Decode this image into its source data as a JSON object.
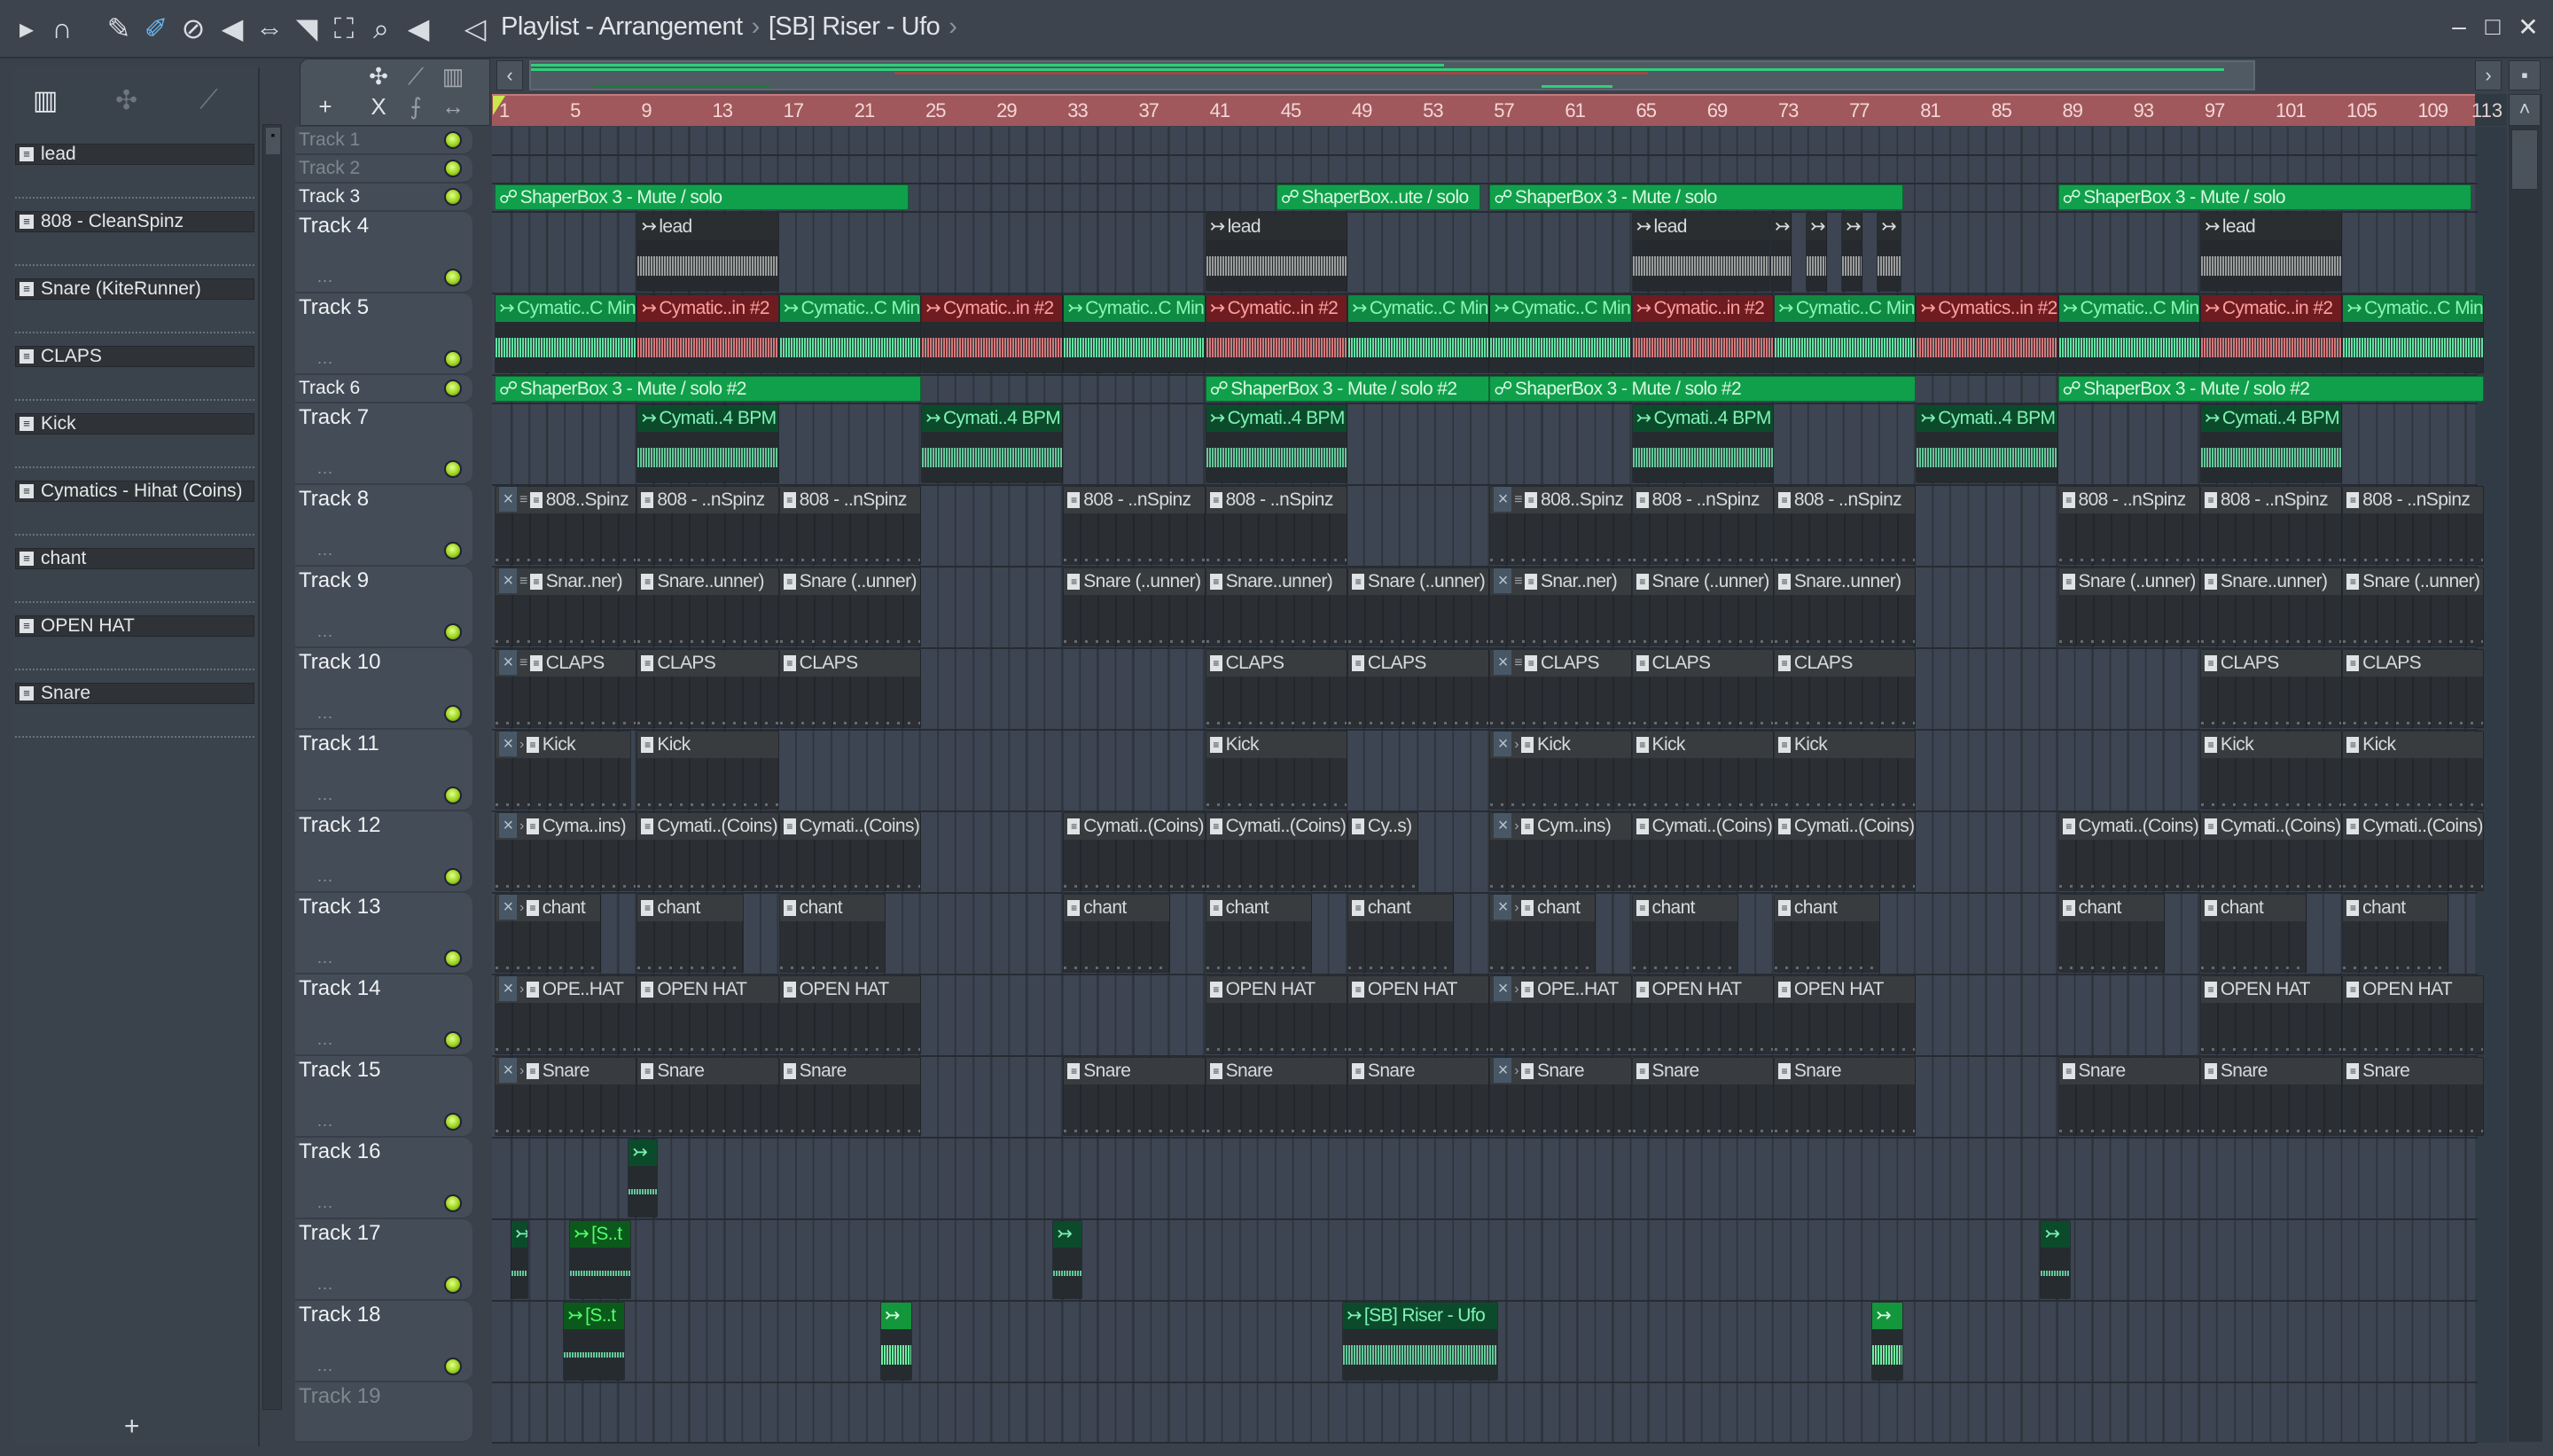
{
  "titlebar": {
    "title": "Playlist - Arrangement",
    "pattern": "[SB] Riser - Ufo",
    "separator": "›",
    "tools": [
      "play-icon",
      "magnet-icon",
      "pencil-icon",
      "paint-icon",
      "delete-icon",
      "mute-icon",
      "slip-icon",
      "slice-icon",
      "select-icon",
      "zoom-icon",
      "playback-icon"
    ],
    "window": {
      "minimize": "–",
      "maximize": "□",
      "close": "✕"
    }
  },
  "accent": {
    "ruler": "#a0585c",
    "auto_clip": "#10a04b",
    "led": "#9bd420"
  },
  "channel_rack": {
    "channels": [
      "lead",
      "808 - CleanSpinz",
      "Snare (KiteRunner)",
      "CLAPS",
      "Kick",
      "Cymatics - Hihat (Coins)",
      "chant",
      "OPEN HAT",
      "Snare"
    ],
    "add_label": "+"
  },
  "ruler": {
    "labels": [
      "1",
      "5",
      "9",
      "13",
      "17",
      "21",
      "25",
      "29",
      "33",
      "37",
      "41",
      "45",
      "49",
      "53",
      "57",
      "61",
      "65",
      "69",
      "73",
      "77",
      "81",
      "85",
      "89",
      "93",
      "97",
      "101",
      "105",
      "109",
      "113"
    ]
  },
  "tracks": [
    {
      "name": "Track 1",
      "dimmed": true,
      "clips": []
    },
    {
      "name": "Track 2",
      "dimmed": true,
      "clips": []
    },
    {
      "name": "Track 3",
      "clips": [
        {
          "s": 1,
          "l": 23.3,
          "t": "auto",
          "label": "ShaperBox 3 - Mute / solo"
        },
        {
          "s": 45,
          "l": 11.5,
          "t": "auto",
          "label": "ShaperBox..ute / solo"
        },
        {
          "s": 57,
          "l": 23.3,
          "t": "auto",
          "label": "ShaperBox 3 - Mute / solo"
        },
        {
          "s": 89,
          "l": 23.3,
          "t": "auto",
          "label": "ShaperBox 3 - Mute / solo"
        }
      ]
    },
    {
      "name": "Track 4",
      "clips": [
        {
          "s": 9,
          "l": 8,
          "t": "audio-gray",
          "label": "lead"
        },
        {
          "s": 41,
          "l": 8,
          "t": "audio-gray",
          "label": "lead"
        },
        {
          "s": 65,
          "l": 7.8,
          "t": "audio-gray",
          "label": "lead"
        },
        {
          "s": 72.8,
          "l": 1.2,
          "t": "audio-gray",
          "label": ""
        },
        {
          "s": 74.8,
          "l": 1.2,
          "t": "audio-gray",
          "label": ""
        },
        {
          "s": 76.8,
          "l": 1.2,
          "t": "audio-gray",
          "label": ""
        },
        {
          "s": 78.8,
          "l": 1.4,
          "t": "audio-gray",
          "label": ""
        },
        {
          "s": 97,
          "l": 8,
          "t": "audio-gray",
          "label": "lead"
        }
      ]
    },
    {
      "name": "Track 5",
      "clips": [
        {
          "s": 1,
          "l": 8,
          "t": "audio-green",
          "label": "Cymatic..C Min"
        },
        {
          "s": 9,
          "l": 8,
          "t": "audio-red",
          "label": "Cymatic..in #2"
        },
        {
          "s": 17,
          "l": 8,
          "t": "audio-green",
          "label": "Cymatic..C Min"
        },
        {
          "s": 25,
          "l": 8,
          "t": "audio-red",
          "label": "Cymatic..in #2"
        },
        {
          "s": 33,
          "l": 8,
          "t": "audio-green",
          "label": "Cymatic..C Min"
        },
        {
          "s": 41,
          "l": 8,
          "t": "audio-red",
          "label": "Cymatic..in #2"
        },
        {
          "s": 49,
          "l": 8,
          "t": "audio-green",
          "label": "Cymatic..C Min"
        },
        {
          "s": 57,
          "l": 8,
          "t": "audio-green",
          "label": "Cymatic..C Min"
        },
        {
          "s": 65,
          "l": 8,
          "t": "audio-red",
          "label": "Cymatic..in #2"
        },
        {
          "s": 73,
          "l": 8,
          "t": "audio-green",
          "label": "Cymatic..C Min"
        },
        {
          "s": 81,
          "l": 8,
          "t": "audio-red",
          "label": "Cymatics..in #2"
        },
        {
          "s": 89,
          "l": 8,
          "t": "audio-green",
          "label": "Cymatic..C Min"
        },
        {
          "s": 97,
          "l": 8,
          "t": "audio-red",
          "label": "Cymatic..in #2"
        },
        {
          "s": 105,
          "l": 8,
          "t": "audio-green",
          "label": "Cymatic..C Min"
        }
      ]
    },
    {
      "name": "Track 6",
      "clips": [
        {
          "s": 1,
          "l": 24,
          "t": "auto",
          "label": "ShaperBox 3 - Mute / solo #2"
        },
        {
          "s": 41,
          "l": 16,
          "t": "auto",
          "label": "ShaperBox 3 - Mute / solo #2"
        },
        {
          "s": 57,
          "l": 24,
          "t": "auto",
          "label": "ShaperBox 3 - Mute / solo #2"
        },
        {
          "s": 89,
          "l": 24,
          "t": "auto",
          "label": "ShaperBox 3 - Mute / solo #2"
        }
      ]
    },
    {
      "name": "Track 7",
      "clips": [
        {
          "s": 9,
          "l": 8,
          "t": "audio-dark",
          "label": "Cymati..4 BPM"
        },
        {
          "s": 25,
          "l": 8,
          "t": "audio-dark",
          "label": "Cymati..4 BPM"
        },
        {
          "s": 41,
          "l": 8,
          "t": "audio-dark",
          "label": "Cymati..4 BPM"
        },
        {
          "s": 65,
          "l": 8,
          "t": "audio-dark",
          "label": "Cymati..4 BPM"
        },
        {
          "s": 81,
          "l": 8,
          "t": "audio-dark",
          "label": "Cymati..4 BPM"
        },
        {
          "s": 97,
          "l": 8,
          "t": "audio-dark",
          "label": "Cymati..4 BPM"
        }
      ]
    },
    {
      "name": "Track 8",
      "clips": [
        {
          "s": 1,
          "l": 8,
          "t": "pattern",
          "label": "808..Spinz",
          "m": true
        },
        {
          "s": 9,
          "l": 8,
          "t": "pattern",
          "label": "808 - ..nSpinz"
        },
        {
          "s": 17,
          "l": 8,
          "t": "pattern",
          "label": "808 - ..nSpinz"
        },
        {
          "s": 33,
          "l": 8,
          "t": "pattern",
          "label": "808 - ..nSpinz"
        },
        {
          "s": 41,
          "l": 8,
          "t": "pattern",
          "label": "808 - ..nSpinz"
        },
        {
          "s": 57,
          "l": 8,
          "t": "pattern",
          "label": "808..Spinz",
          "m": true
        },
        {
          "s": 65,
          "l": 8,
          "t": "pattern",
          "label": "808 - ..nSpinz"
        },
        {
          "s": 73,
          "l": 8,
          "t": "pattern",
          "label": "808 - ..nSpinz"
        },
        {
          "s": 89,
          "l": 8,
          "t": "pattern",
          "label": "808 - ..nSpinz"
        },
        {
          "s": 97,
          "l": 8,
          "t": "pattern",
          "label": "808 - ..nSpinz"
        },
        {
          "s": 105,
          "l": 8,
          "t": "pattern",
          "label": "808 - ..nSpinz"
        }
      ]
    },
    {
      "name": "Track 9",
      "clips": [
        {
          "s": 1,
          "l": 8,
          "t": "pattern",
          "label": "Snar..ner)",
          "m": true
        },
        {
          "s": 9,
          "l": 8,
          "t": "pattern",
          "label": "Snare..unner)"
        },
        {
          "s": 17,
          "l": 8,
          "t": "pattern",
          "label": "Snare (..unner)"
        },
        {
          "s": 33,
          "l": 8,
          "t": "pattern",
          "label": "Snare (..unner)"
        },
        {
          "s": 41,
          "l": 8,
          "t": "pattern",
          "label": "Snare..unner)"
        },
        {
          "s": 49,
          "l": 8,
          "t": "pattern",
          "label": "Snare (..unner)"
        },
        {
          "s": 57,
          "l": 8,
          "t": "pattern",
          "label": "Snar..ner)",
          "m": true
        },
        {
          "s": 65,
          "l": 8,
          "t": "pattern",
          "label": "Snare (..unner)"
        },
        {
          "s": 73,
          "l": 8,
          "t": "pattern",
          "label": "Snare..unner)"
        },
        {
          "s": 89,
          "l": 8,
          "t": "pattern",
          "label": "Snare (..unner)"
        },
        {
          "s": 97,
          "l": 8,
          "t": "pattern",
          "label": "Snare..unner)"
        },
        {
          "s": 105,
          "l": 8,
          "t": "pattern",
          "label": "Snare (..unner)"
        }
      ]
    },
    {
      "name": "Track 10",
      "clips": [
        {
          "s": 1,
          "l": 8,
          "t": "pattern",
          "label": "CLAPS",
          "m": true
        },
        {
          "s": 9,
          "l": 8,
          "t": "pattern",
          "label": "CLAPS"
        },
        {
          "s": 17,
          "l": 8,
          "t": "pattern",
          "label": "CLAPS"
        },
        {
          "s": 41,
          "l": 8,
          "t": "pattern",
          "label": "CLAPS"
        },
        {
          "s": 49,
          "l": 8,
          "t": "pattern",
          "label": "CLAPS"
        },
        {
          "s": 57,
          "l": 8,
          "t": "pattern",
          "label": "CLAPS",
          "m": true
        },
        {
          "s": 65,
          "l": 8,
          "t": "pattern",
          "label": "CLAPS"
        },
        {
          "s": 73,
          "l": 8,
          "t": "pattern",
          "label": "CLAPS"
        },
        {
          "s": 97,
          "l": 8,
          "t": "pattern",
          "label": "CLAPS"
        },
        {
          "s": 105,
          "l": 8,
          "t": "pattern",
          "label": "CLAPS"
        }
      ]
    },
    {
      "name": "Track 11",
      "clips": [
        {
          "s": 1,
          "l": 7.7,
          "t": "pattern",
          "label": "Kick",
          "m": true
        },
        {
          "s": 9,
          "l": 8,
          "t": "pattern",
          "label": "Kick"
        },
        {
          "s": 41,
          "l": 8,
          "t": "pattern",
          "label": "Kick"
        },
        {
          "s": 57,
          "l": 8,
          "t": "pattern",
          "label": "Kick",
          "m": true
        },
        {
          "s": 65,
          "l": 8,
          "t": "pattern",
          "label": "Kick"
        },
        {
          "s": 73,
          "l": 8,
          "t": "pattern",
          "label": "Kick"
        },
        {
          "s": 97,
          "l": 8,
          "t": "pattern",
          "label": "Kick"
        },
        {
          "s": 105,
          "l": 8,
          "t": "pattern",
          "label": "Kick"
        }
      ]
    },
    {
      "name": "Track 12",
      "clips": [
        {
          "s": 1,
          "l": 8,
          "t": "pattern",
          "label": "Cyma..ins)",
          "m": true
        },
        {
          "s": 9,
          "l": 8,
          "t": "pattern",
          "label": "Cymati..(Coins)"
        },
        {
          "s": 17,
          "l": 8,
          "t": "pattern",
          "label": "Cymati..(Coins)"
        },
        {
          "s": 33,
          "l": 8,
          "t": "pattern",
          "label": "Cymati..(Coins)"
        },
        {
          "s": 41,
          "l": 8,
          "t": "pattern",
          "label": "Cymati..(Coins)"
        },
        {
          "s": 49,
          "l": 4,
          "t": "pattern",
          "label": "Cy..s)"
        },
        {
          "s": 57,
          "l": 8,
          "t": "pattern",
          "label": "Cym..ins)",
          "m": true
        },
        {
          "s": 65,
          "l": 8,
          "t": "pattern",
          "label": "Cymati..(Coins)"
        },
        {
          "s": 73,
          "l": 8,
          "t": "pattern",
          "label": "Cymati..(Coins)"
        },
        {
          "s": 89,
          "l": 8,
          "t": "pattern",
          "label": "Cymati..(Coins)"
        },
        {
          "s": 97,
          "l": 8,
          "t": "pattern",
          "label": "Cymati..(Coins)"
        },
        {
          "s": 105,
          "l": 8,
          "t": "pattern",
          "label": "Cymati..(Coins)"
        }
      ]
    },
    {
      "name": "Track 13",
      "clips": [
        {
          "s": 1,
          "l": 6,
          "t": "pattern",
          "label": "chant",
          "m": true
        },
        {
          "s": 9,
          "l": 6,
          "t": "pattern",
          "label": "chant"
        },
        {
          "s": 17,
          "l": 6,
          "t": "pattern",
          "label": "chant"
        },
        {
          "s": 33,
          "l": 6,
          "t": "pattern",
          "label": "chant"
        },
        {
          "s": 41,
          "l": 6,
          "t": "pattern",
          "label": "chant"
        },
        {
          "s": 49,
          "l": 6,
          "t": "pattern",
          "label": "chant"
        },
        {
          "s": 57,
          "l": 6,
          "t": "pattern",
          "label": "chant",
          "m": true
        },
        {
          "s": 65,
          "l": 6,
          "t": "pattern",
          "label": "chant"
        },
        {
          "s": 73,
          "l": 6,
          "t": "pattern",
          "label": "chant"
        },
        {
          "s": 89,
          "l": 6,
          "t": "pattern",
          "label": "chant"
        },
        {
          "s": 97,
          "l": 6,
          "t": "pattern",
          "label": "chant"
        },
        {
          "s": 105,
          "l": 6,
          "t": "pattern",
          "label": "chant"
        }
      ]
    },
    {
      "name": "Track 14",
      "clips": [
        {
          "s": 1,
          "l": 8,
          "t": "pattern",
          "label": "OPE..HAT",
          "m": true
        },
        {
          "s": 9,
          "l": 8,
          "t": "pattern",
          "label": "OPEN HAT"
        },
        {
          "s": 17,
          "l": 8,
          "t": "pattern",
          "label": "OPEN HAT"
        },
        {
          "s": 41,
          "l": 8,
          "t": "pattern",
          "label": "OPEN HAT"
        },
        {
          "s": 49,
          "l": 8,
          "t": "pattern",
          "label": "OPEN HAT"
        },
        {
          "s": 57,
          "l": 8,
          "t": "pattern",
          "label": "OPE..HAT",
          "m": true
        },
        {
          "s": 65,
          "l": 8,
          "t": "pattern",
          "label": "OPEN HAT"
        },
        {
          "s": 73,
          "l": 8,
          "t": "pattern",
          "label": "OPEN HAT"
        },
        {
          "s": 97,
          "l": 8,
          "t": "pattern",
          "label": "OPEN HAT"
        },
        {
          "s": 105,
          "l": 8,
          "t": "pattern",
          "label": "OPEN HAT"
        }
      ]
    },
    {
      "name": "Track 15",
      "clips": [
        {
          "s": 1,
          "l": 8,
          "t": "pattern",
          "label": "Snare",
          "m": true
        },
        {
          "s": 9,
          "l": 8,
          "t": "pattern",
          "label": "Snare"
        },
        {
          "s": 17,
          "l": 8,
          "t": "pattern",
          "label": "Snare"
        },
        {
          "s": 33,
          "l": 8,
          "t": "pattern",
          "label": "Snare"
        },
        {
          "s": 41,
          "l": 8,
          "t": "pattern",
          "label": "Snare"
        },
        {
          "s": 49,
          "l": 8,
          "t": "pattern",
          "label": "Snare"
        },
        {
          "s": 57,
          "l": 8,
          "t": "pattern",
          "label": "Snare",
          "m": true
        },
        {
          "s": 65,
          "l": 8,
          "t": "pattern",
          "label": "Snare"
        },
        {
          "s": 73,
          "l": 8,
          "t": "pattern",
          "label": "Snare"
        },
        {
          "s": 89,
          "l": 8,
          "t": "pattern",
          "label": "Snare"
        },
        {
          "s": 97,
          "l": 8,
          "t": "pattern",
          "label": "Snare"
        },
        {
          "s": 105,
          "l": 8,
          "t": "pattern",
          "label": "Snare"
        }
      ]
    },
    {
      "name": "Track 16",
      "clips": [
        {
          "s": 8.5,
          "l": 1.7,
          "t": "audio-dark",
          "label": ""
        }
      ]
    },
    {
      "name": "Track 17",
      "clips": [
        {
          "s": 1.9,
          "l": 1,
          "t": "audio-dark",
          "label": ""
        },
        {
          "s": 5.2,
          "l": 3.5,
          "t": "audio-lime",
          "label": "[S..t"
        },
        {
          "s": 32.4,
          "l": 1.7,
          "t": "audio-dark",
          "label": ""
        },
        {
          "s": 88,
          "l": 1.7,
          "t": "audio-dark",
          "label": ""
        }
      ]
    },
    {
      "name": "Track 18",
      "clips": [
        {
          "s": 4.85,
          "l": 3.5,
          "t": "audio-lime",
          "label": "[S..t"
        },
        {
          "s": 22.7,
          "l": 1.8,
          "t": "audio-bright",
          "label": ""
        },
        {
          "s": 48.7,
          "l": 8.8,
          "t": "audio-dark",
          "label": "[SB] Riser - Ufo"
        },
        {
          "s": 78.5,
          "l": 1.8,
          "t": "audio-bright",
          "label": ""
        }
      ]
    },
    {
      "name": "Track 19",
      "dimmed": true,
      "clips": []
    }
  ]
}
